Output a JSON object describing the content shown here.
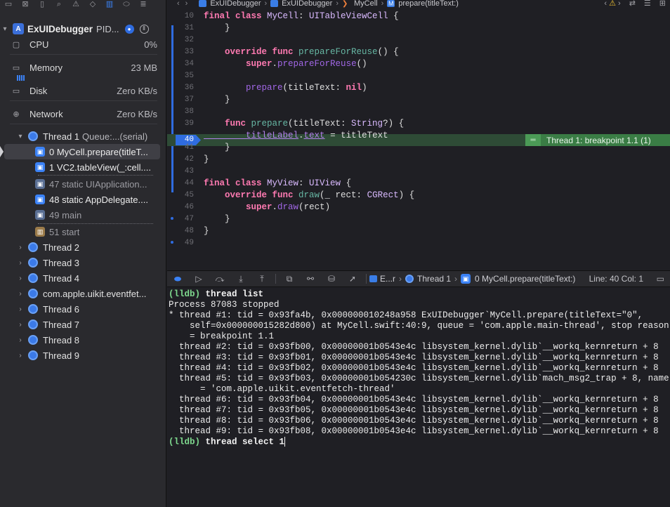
{
  "navigator": {
    "toolbar_icons": [
      "folder-icon",
      "source-control-icon",
      "bookmark-icon",
      "search-icon",
      "issue-icon",
      "test-icon",
      "debug-icon",
      "breakpoint-icon",
      "report-icon"
    ],
    "process": {
      "name": "ExUIDebugger",
      "pid_label": "PID..."
    },
    "gauges": [
      {
        "label": "CPU",
        "value": "0%"
      },
      {
        "label": "Memory",
        "value": "23 MB"
      },
      {
        "label": "Disk",
        "value": "Zero KB/s"
      },
      {
        "label": "Network",
        "value": "Zero KB/s"
      }
    ],
    "thread1": {
      "label": "Thread 1",
      "queue": "Queue:...(serial)"
    },
    "frames": [
      {
        "label": "0 MyCell.prepare(titleT...",
        "kind": "user"
      },
      {
        "label": "1 VC2.tableView(_:cell....",
        "kind": "user"
      },
      {
        "label": "47 static UIApplication...",
        "kind": "sys"
      },
      {
        "label": "48 static AppDelegate....",
        "kind": "user"
      },
      {
        "label": "49 main",
        "kind": "sys"
      },
      {
        "label": "51 start",
        "kind": "sys"
      }
    ],
    "threads": [
      "Thread 2",
      "Thread 3",
      "Thread 4",
      "com.apple.uikit.eventfet...",
      "Thread 6",
      "Thread 7",
      "Thread 8",
      "Thread 9"
    ]
  },
  "editor": {
    "jumpbar": {
      "project": "ExUIDebugger",
      "group": "ExUIDebugger",
      "file": "MyCell",
      "symbol": "prepare(titleText:)"
    },
    "breakpoint_badge": "Thread 1: breakpoint 1.1 (1)",
    "lines": [
      {
        "n": "10",
        "code": [
          [
            "kw",
            "final class "
          ],
          [
            "ty",
            "MyCell"
          ],
          [
            "pl",
            ": "
          ],
          [
            "ty",
            "UITableViewCell"
          ],
          [
            "pl",
            " {"
          ]
        ]
      },
      {
        "n": "31",
        "code": [
          [
            "pl",
            "    }"
          ]
        ]
      },
      {
        "n": "32",
        "code": []
      },
      {
        "n": "33",
        "code": [
          [
            "kw",
            "    override func "
          ],
          [
            "fn",
            "prepareForReuse"
          ],
          [
            "pl",
            "() {"
          ]
        ]
      },
      {
        "n": "34",
        "code": [
          [
            "kw",
            "        super"
          ],
          [
            "pl",
            "."
          ],
          [
            "fnc",
            "prepareForReuse"
          ],
          [
            "pl",
            "()"
          ]
        ]
      },
      {
        "n": "35",
        "code": []
      },
      {
        "n": "36",
        "code": [
          [
            "fnc",
            "        prepare"
          ],
          [
            "pl",
            "(titleText: "
          ],
          [
            "kw",
            "nil"
          ],
          [
            "pl",
            ")"
          ]
        ]
      },
      {
        "n": "37",
        "code": [
          [
            "pl",
            "    }"
          ]
        ]
      },
      {
        "n": "38",
        "code": []
      },
      {
        "n": "39",
        "code": [
          [
            "kw",
            "    func "
          ],
          [
            "fn",
            "prepare"
          ],
          [
            "pl",
            "(titleText: "
          ],
          [
            "ty",
            "String"
          ],
          [
            "pl",
            "?) {"
          ]
        ]
      },
      {
        "n": "40",
        "code": [
          [
            "id",
            "        titleLabel"
          ],
          [
            "pl",
            "."
          ],
          [
            "id",
            "text"
          ],
          [
            "pl",
            " = titleText"
          ]
        ]
      },
      {
        "n": "41",
        "code": [
          [
            "pl",
            "    }"
          ]
        ]
      },
      {
        "n": "42",
        "code": [
          [
            "pl",
            "}"
          ]
        ]
      },
      {
        "n": "43",
        "code": []
      },
      {
        "n": "44",
        "code": [
          [
            "kw",
            "final class "
          ],
          [
            "ty",
            "MyView"
          ],
          [
            "pl",
            ": "
          ],
          [
            "ty",
            "UIView"
          ],
          [
            "pl",
            " {"
          ]
        ]
      },
      {
        "n": "45",
        "code": [
          [
            "kw",
            "    override func "
          ],
          [
            "fn",
            "draw"
          ],
          [
            "pl",
            "(_ rect: "
          ],
          [
            "ty",
            "CGRect"
          ],
          [
            "pl",
            ") {"
          ]
        ]
      },
      {
        "n": "46",
        "code": [
          [
            "kw",
            "        super"
          ],
          [
            "pl",
            "."
          ],
          [
            "fnc",
            "draw"
          ],
          [
            "pl",
            "(rect)"
          ]
        ]
      },
      {
        "n": "47",
        "code": [
          [
            "pl",
            "    }"
          ]
        ]
      },
      {
        "n": "48",
        "code": [
          [
            "pl",
            "}"
          ]
        ]
      },
      {
        "n": "49",
        "code": []
      }
    ]
  },
  "debugbar": {
    "crumb_project": "E...r",
    "crumb_thread": "Thread 1",
    "crumb_frame": "0 MyCell.prepare(titleText:)",
    "position": "Line: 40  Col: 1"
  },
  "console": {
    "lines": [
      {
        "prompt": "(lldb) ",
        "cmd": "thread list"
      },
      {
        "text": "Process 87083 stopped"
      },
      {
        "text": "* thread #1: tid = 0x93fa4b, 0x000000010248a958 ExUIDebugger`MyCell.prepare(titleText=\"0\","
      },
      {
        "text": "    self=0x000000015282d800) at MyCell.swift:40:9, queue = 'com.apple.main-thread', stop reason"
      },
      {
        "text": "    = breakpoint 1.1"
      },
      {
        "text": "  thread #2: tid = 0x93fb00, 0x00000001b0543e4c libsystem_kernel.dylib`__workq_kernreturn + 8"
      },
      {
        "text": "  thread #3: tid = 0x93fb01, 0x00000001b0543e4c libsystem_kernel.dylib`__workq_kernreturn + 8"
      },
      {
        "text": "  thread #4: tid = 0x93fb02, 0x00000001b0543e4c libsystem_kernel.dylib`__workq_kernreturn + 8"
      },
      {
        "text": "  thread #5: tid = 0x93fb03, 0x00000001b054230c libsystem_kernel.dylib`mach_msg2_trap + 8, name"
      },
      {
        "text": "      = 'com.apple.uikit.eventfetch-thread'"
      },
      {
        "text": "  thread #6: tid = 0x93fb04, 0x00000001b0543e4c libsystem_kernel.dylib`__workq_kernreturn + 8"
      },
      {
        "text": "  thread #7: tid = 0x93fb05, 0x00000001b0543e4c libsystem_kernel.dylib`__workq_kernreturn + 8"
      },
      {
        "text": "  thread #8: tid = 0x93fb06, 0x00000001b0543e4c libsystem_kernel.dylib`__workq_kernreturn + 8"
      },
      {
        "text": "  thread #9: tid = 0x93fb08, 0x00000001b0543e4c libsystem_kernel.dylib`__workq_kernreturn + 8"
      },
      {
        "prompt": "(lldb) ",
        "cmd": "thread select 1",
        "caret": true
      }
    ]
  }
}
